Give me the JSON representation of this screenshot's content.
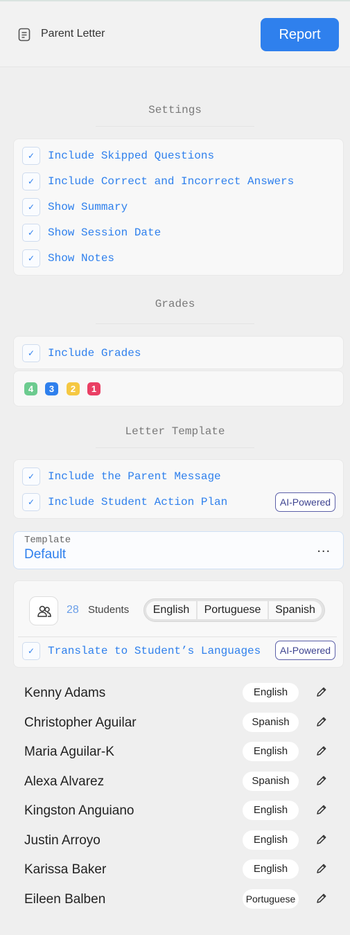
{
  "header": {
    "title": "Parent Letter",
    "report_label": "Report",
    "icon": "document-icon"
  },
  "settings": {
    "title": "Settings",
    "options": [
      {
        "label": "Include Skipped Questions",
        "checked": true
      },
      {
        "label": "Include Correct and Incorrect Answers",
        "checked": true
      },
      {
        "label": "Show Summary",
        "checked": true
      },
      {
        "label": "Show Session Date",
        "checked": true
      },
      {
        "label": "Show Notes",
        "checked": true
      }
    ]
  },
  "grades": {
    "title": "Grades",
    "include_label": "Include Grades",
    "checked": true,
    "chips": [
      {
        "label": "4",
        "color": "#6ccb8f"
      },
      {
        "label": "3",
        "color": "#2f80ed"
      },
      {
        "label": "2",
        "color": "#f5c842"
      },
      {
        "label": "1",
        "color": "#ea3f64"
      }
    ]
  },
  "letter_template": {
    "title": "Letter Template",
    "options": [
      {
        "label": "Include the Parent Message",
        "checked": true
      },
      {
        "label": "Include Student Action Plan",
        "checked": true,
        "badge": "AI-Powered"
      }
    ],
    "template_field": {
      "label": "Template",
      "value": "Default",
      "more": "..."
    }
  },
  "translation": {
    "student_count": "28",
    "students_label": "Students",
    "languages": [
      "English",
      "Portuguese",
      "Spanish"
    ],
    "translate_label": "Translate to Student’s Languages",
    "translate_checked": true,
    "badge": "AI-Powered"
  },
  "students": [
    {
      "name": "Kenny Adams",
      "language": "English"
    },
    {
      "name": "Christopher Aguilar",
      "language": "Spanish"
    },
    {
      "name": "Maria Aguilar-K",
      "language": "English"
    },
    {
      "name": "Alexa Alvarez",
      "language": "Spanish"
    },
    {
      "name": "Kingston Anguiano",
      "language": "English"
    },
    {
      "name": "Justin Arroyo",
      "language": "English"
    },
    {
      "name": "Karissa Baker",
      "language": "English"
    },
    {
      "name": "Eileen Balben",
      "language": "Portuguese"
    }
  ],
  "colors": {
    "accent": "#2f80ed",
    "ai_badge": "#3d4390"
  }
}
